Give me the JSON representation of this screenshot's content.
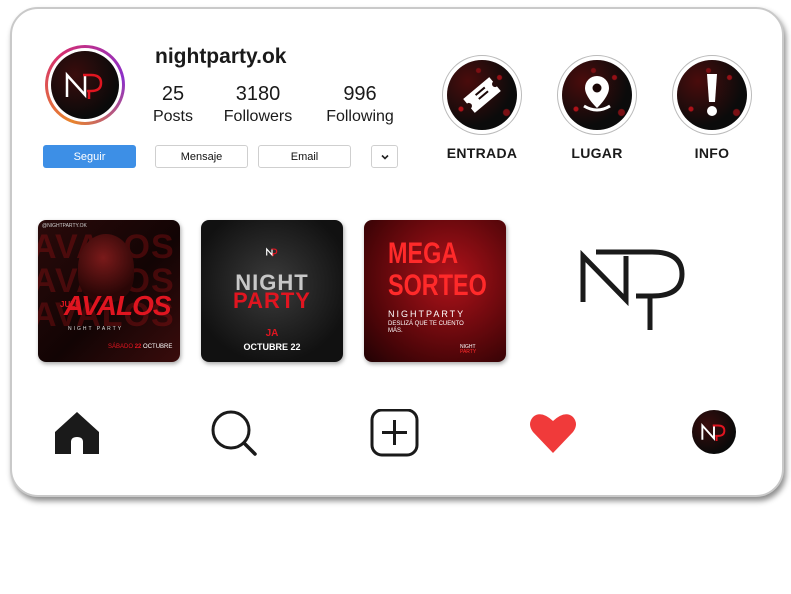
{
  "profile": {
    "username": "nightparty.ok",
    "stats": [
      {
        "value": "25",
        "label": "Posts"
      },
      {
        "value": "3180",
        "label": "Followers"
      },
      {
        "value": "996",
        "label": "Following"
      }
    ]
  },
  "actions": {
    "follow": "Seguir",
    "message": "Mensaje",
    "email": "Email"
  },
  "highlights": [
    {
      "label": "ENTRADA",
      "icon": "ticket-icon"
    },
    {
      "label": "LUGAR",
      "icon": "location-pin-icon"
    },
    {
      "label": "INFO",
      "icon": "exclamation-icon"
    }
  ],
  "posts": {
    "p1": {
      "handle": "@NIGHTPARTY.OK",
      "big": "AVALOS",
      "pre": "JULI",
      "sub": "NIGHT PARTY",
      "date_a": "SÁBADO",
      "date_b": "22",
      "date_c": "OCTUBRE",
      "bg_text": "AVALOS"
    },
    "p2": {
      "line1": "NIGHT",
      "line2": "PARTY",
      "date": "OCTUBRE 22"
    },
    "p3": {
      "line1": "MEGA",
      "line2": "SORTEO",
      "brand": "NIGHTPARTY",
      "note": "DESLIZÁ QUE TE CUENTO MÁS.",
      "badge_a": "NIGHT",
      "badge_b": "PARTY"
    }
  },
  "colors": {
    "accent": "#3d8fe6",
    "heart": "#f03a3a",
    "brand_red": "#d8121c"
  },
  "nav": [
    "home-icon",
    "search-icon",
    "add-post-icon",
    "heart-icon",
    "profile-avatar-icon"
  ]
}
